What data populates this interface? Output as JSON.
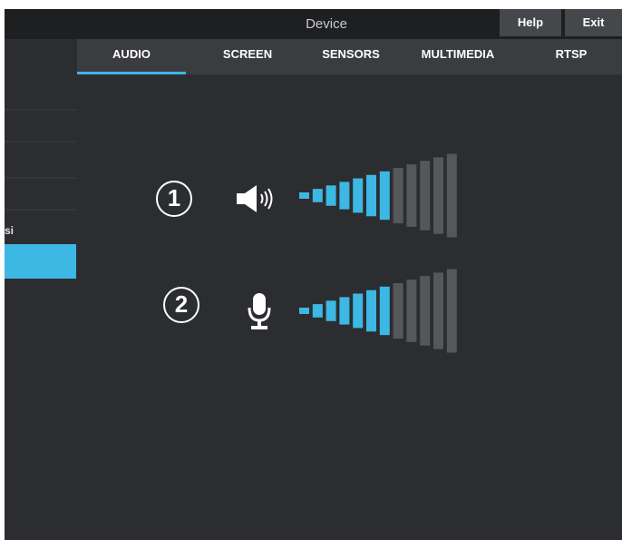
{
  "window": {
    "title": "Device",
    "help_label": "Help",
    "exit_label": "Exit"
  },
  "tabs": [
    {
      "label": "AUDIO",
      "active": true
    },
    {
      "label": "SCREEN",
      "active": false
    },
    {
      "label": "SENSORS",
      "active": false
    },
    {
      "label": "MULTIMEDIA",
      "active": false
    },
    {
      "label": "RTSP",
      "active": false
    }
  ],
  "sidebar": {
    "partial_label": "si"
  },
  "audio": {
    "speaker": {
      "callout": "1",
      "icon": "speaker-volume-icon",
      "total_steps": 12,
      "active_steps": 7
    },
    "microphone": {
      "callout": "2",
      "icon": "microphone-icon",
      "total_steps": 12,
      "active_steps": 7
    }
  },
  "colors": {
    "accent": "#3db7e4",
    "inactive_bar": "#55575a",
    "background": "#2b2d30",
    "titlebar": "#1e1f21",
    "tabbar": "#3a3c40"
  }
}
